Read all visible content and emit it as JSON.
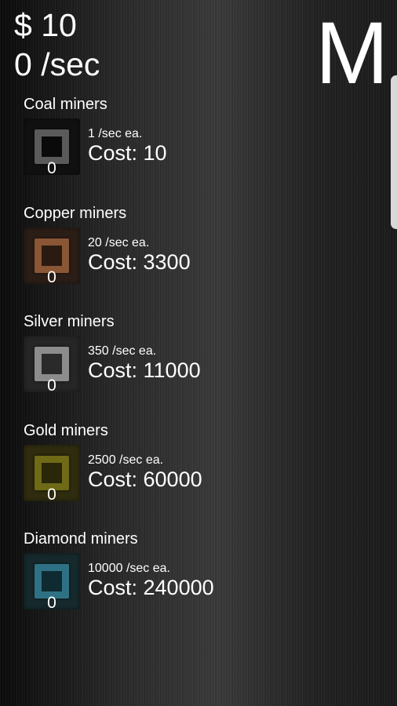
{
  "header": {
    "money": "$ 10",
    "income_rate": "0 /sec",
    "big_letter": "M"
  },
  "miners": [
    {
      "title": "Coal miners",
      "owned": "0",
      "rate": "1 /sec ea.",
      "cost": "Cost: 10",
      "color": "#5a5a5a"
    },
    {
      "title": "Copper miners",
      "owned": "0",
      "rate": "20 /sec ea.",
      "cost": "Cost: 3300",
      "color": "#8a5634"
    },
    {
      "title": "Silver miners",
      "owned": "0",
      "rate": "350 /sec ea.",
      "cost": "Cost: 11000",
      "color": "#8c8c8c"
    },
    {
      "title": "Gold miners",
      "owned": "0",
      "rate": "2500 /sec ea.",
      "cost": "Cost: 60000",
      "color": "#6f6a16"
    },
    {
      "title": "Diamond miners",
      "owned": "0",
      "rate": "10000 /sec ea.",
      "cost": "Cost: 240000",
      "color": "#2f7184"
    }
  ]
}
